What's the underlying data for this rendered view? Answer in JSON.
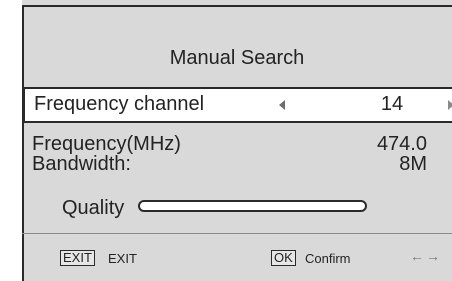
{
  "window": {
    "title": "Manual Search"
  },
  "selected_row": {
    "label": "Frequency channel",
    "value": "14",
    "left_arrow_icon": "triangle-left-icon",
    "right_arrow_icon": "triangle-right-icon"
  },
  "info": {
    "frequency_label": "Frequency(MHz)",
    "frequency_value": "474.0",
    "bandwidth_label": "Bandwidth:",
    "bandwidth_value": "8M"
  },
  "quality": {
    "label": "Quality",
    "level": 0
  },
  "footer": {
    "exit_key": "EXIT",
    "exit_label": "EXIT",
    "ok_key": "OK",
    "ok_label": "Confirm",
    "nav_icon": "left-right-arrows-icon",
    "nav_glyph": "←→"
  },
  "colors": {
    "panel": "#d9d9d9",
    "selection": "#ffffff",
    "text": "#232323",
    "border": "#2a2a2a"
  }
}
